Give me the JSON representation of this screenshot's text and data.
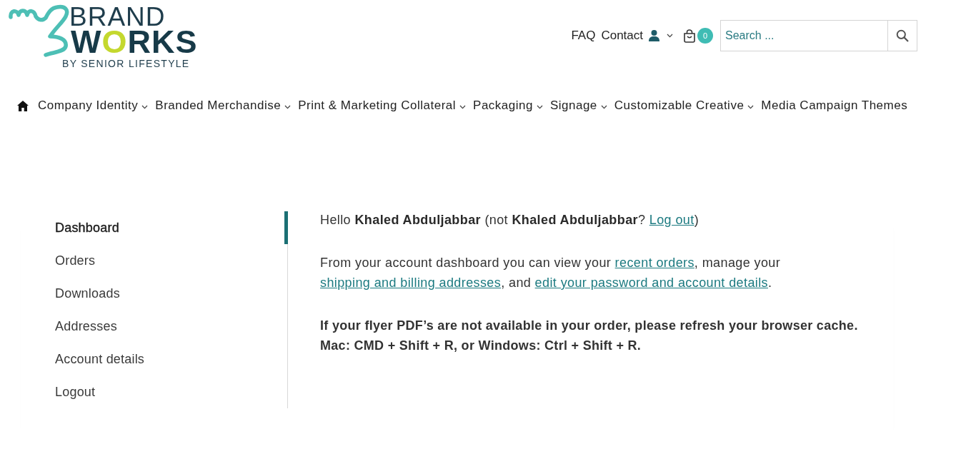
{
  "header": {
    "logo": {
      "line_1": "BRAND",
      "line_2": "WORKS",
      "tagline": "BY SENIOR LIFESTYLE"
    },
    "top_links": [
      "FAQ",
      "Contact"
    ],
    "cart": {
      "count": "0"
    },
    "search": {
      "placeholder": "Search ..."
    }
  },
  "main_nav": {
    "items": [
      {
        "label": "Company Identity",
        "has_dropdown": true
      },
      {
        "label": "Branded Merchandise",
        "has_dropdown": true
      },
      {
        "label": "Print & Marketing Collateral",
        "has_dropdown": true
      },
      {
        "label": "Packaging",
        "has_dropdown": true
      },
      {
        "label": "Signage",
        "has_dropdown": true
      },
      {
        "label": "Customizable Creative",
        "has_dropdown": true
      },
      {
        "label": "Media Campaign Themes",
        "has_dropdown": false
      }
    ]
  },
  "account_nav": {
    "items": [
      {
        "label": "Dashboard",
        "selected": true
      },
      {
        "label": "Orders",
        "selected": false
      },
      {
        "label": "Downloads",
        "selected": false
      },
      {
        "label": "Addresses",
        "selected": false
      },
      {
        "label": "Account details",
        "selected": false
      },
      {
        "label": "Logout",
        "selected": false
      }
    ]
  },
  "content": {
    "paragraphs": [
      {
        "kind": "greeting",
        "parts": [
          {
            "kind": "text",
            "text": "Hello **Khaled Abduljabbar** (not **Khaled Abduljabbar**? "
          },
          {
            "kind": "link",
            "text": "Log out"
          },
          {
            "kind": "text",
            "text": ")"
          }
        ]
      },
      {
        "kind": "info",
        "parts": [
          {
            "kind": "text",
            "text": "From your account dashboard you can view your "
          },
          {
            "kind": "link",
            "text": "recent orders"
          },
          {
            "kind": "text",
            "text": ", manage your "
          },
          {
            "kind": "link",
            "text": "shipping and billing addresses"
          },
          {
            "kind": "text",
            "text": ", and "
          },
          {
            "kind": "link",
            "text": "edit your password and account details"
          },
          {
            "kind": "text",
            "text": "."
          }
        ]
      },
      {
        "kind": "notice",
        "parts": [
          {
            "kind": "text",
            "text": "If your flyer PDF’s are not available in your order, please refresh your browser cache. Mac: CMD + Shift + R, or Windows: Ctrl + Shift + R."
          }
        ]
      }
    ]
  }
}
